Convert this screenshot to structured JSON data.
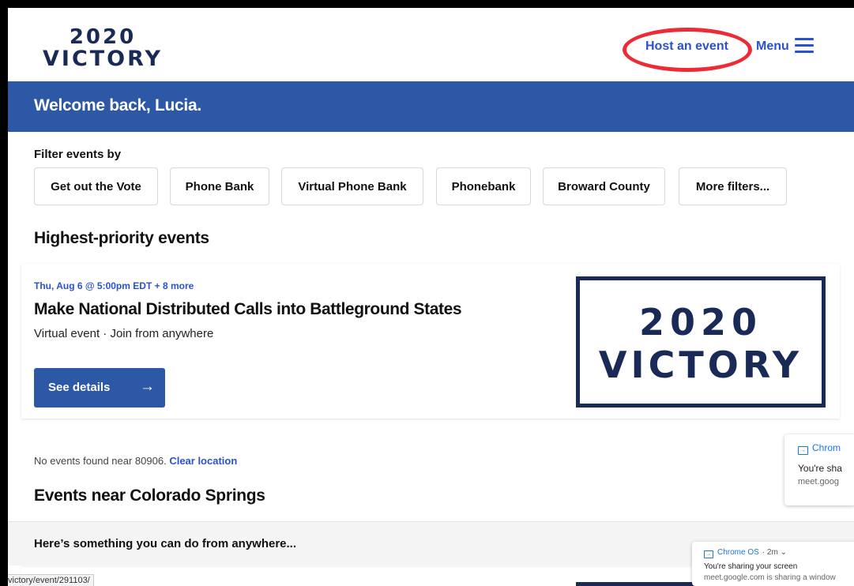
{
  "header": {
    "logo_line1": "2020",
    "logo_line2": "VICTORY",
    "host_event": "Host an event",
    "menu": "Menu"
  },
  "welcome": "Welcome back, Lucia.",
  "filters": {
    "label": "Filter events by",
    "chips": [
      "Get out the Vote",
      "Phone Bank",
      "Virtual Phone Bank",
      "Phonebank",
      "Broward County",
      "More filters..."
    ]
  },
  "priority": {
    "title": "Highest-priority events",
    "event": {
      "date": "Thu, Aug 6 @ 5:00pm EDT + 8 more",
      "title": "Make National Distributed Calls into Battleground States",
      "location": "Virtual event · Join from anywhere",
      "button": "See details",
      "logo_line1": "2020",
      "logo_line2": "VICTORY"
    }
  },
  "nearby": {
    "message": "No events found near 80906.",
    "clear_link": "Clear location",
    "title": "Events near Colorado Springs",
    "anywhere": "Here’s something you can do from anywhere..."
  },
  "status_url": "victory/event/291103/",
  "notifications": [
    {
      "source": "Chrom",
      "title": "You're sha",
      "body": "meet.goog"
    },
    {
      "source": "Chrome OS",
      "meta": "· 2m ⌄",
      "title": "You're sharing your screen",
      "body": "meet.google.com is sharing a window"
    }
  ],
  "colors": {
    "brand_blue": "#2d58a5",
    "link_blue": "#2b52cc",
    "navy": "#1a2a57",
    "annotation_red": "#ee2a36"
  }
}
